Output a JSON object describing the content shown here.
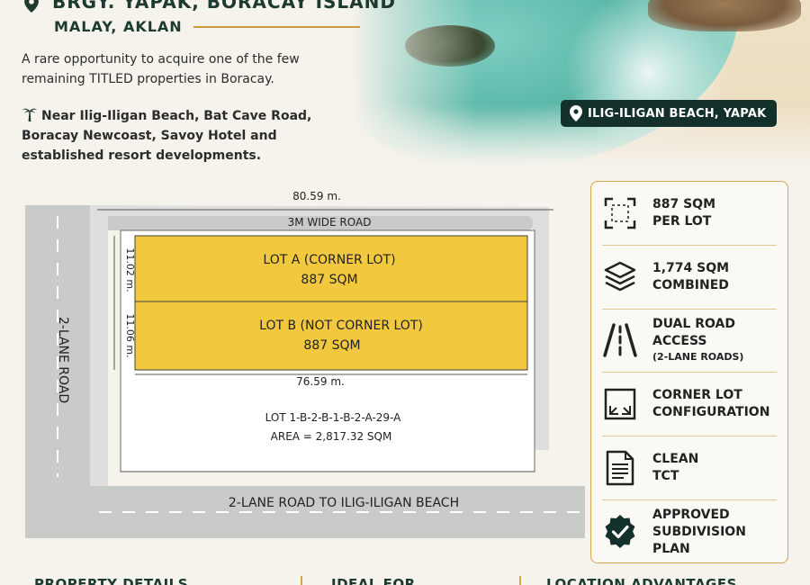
{
  "header": {
    "title": "BRGY. YAPAK, BORACAY ISLAND",
    "subtitle": "MALAY, AKLAN",
    "intro": "A rare opportunity to acquire one of the few remaining TITLED properties in Boracay.",
    "near_text": "Near Ilig-Iligan Beach, Bat Cave Road, Boracay Newcoast, Savoy Hotel and established resort developments."
  },
  "location_badge": "ILIG-ILIGAN BEACH, YAPAK",
  "site_plan": {
    "top_dimension": "80.59 m.",
    "top_road": "3M WIDE ROAD",
    "left_road": "2-LANE ROAD",
    "bottom_road": "2-LANE ROAD TO ILIG-ILIGAN BEACH",
    "lot_a_name": "LOT A (CORNER LOT)",
    "lot_a_area": "887 SQM",
    "lot_a_depth": "11.02 m.",
    "lot_b_name": "LOT B (NOT CORNER LOT)",
    "lot_b_area": "887 SQM",
    "lot_b_depth": "11.06 m.",
    "lower_dimension": "76.59 m.",
    "mother_lot": "LOT 1-B-2-B-1-B-2-A-29-A",
    "mother_area": "AREA = 2,817.32 SQM",
    "colors": {
      "lot_fill": "#f2c93e",
      "road": "#c9cbc8",
      "lot_border": "#3e3e3e"
    }
  },
  "features": [
    {
      "icon": "expand-corners-icon",
      "line1": "887 SQM",
      "line2": "PER LOT",
      "note": ""
    },
    {
      "icon": "layers-icon",
      "line1": "1,774 SQM",
      "line2": "COMBINED",
      "note": ""
    },
    {
      "icon": "road-icon",
      "line1": "DUAL ROAD",
      "line2": "ACCESS",
      "note": "(2-LANE ROADS)"
    },
    {
      "icon": "corner-lot-icon",
      "line1": "CORNER LOT",
      "line2": "CONFIGURATION",
      "note": ""
    },
    {
      "icon": "document-icon",
      "line1": "CLEAN",
      "line2": "TCT",
      "note": ""
    },
    {
      "icon": "check-badge-icon",
      "line1": "APPROVED",
      "line2": "SUBDIVISION PLAN",
      "note": ""
    }
  ],
  "bottom_sections": [
    "PROPERTY DETAILS",
    "IDEAL FOR",
    "LOCATION ADVANTAGES"
  ],
  "colors": {
    "accent": "#d9a54a",
    "brand_dark": "#14302a",
    "text_dark": "#1d3a30"
  }
}
